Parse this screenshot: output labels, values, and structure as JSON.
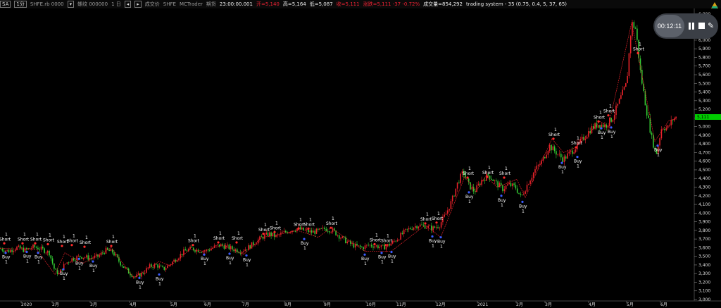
{
  "header": {
    "symbol_box": "SA",
    "interval_box": "1分",
    "symbol": "SHFE.rb 0000",
    "contract": "螺纹 000000",
    "period": "1 日",
    "price_type": "成交价",
    "exchange": "SHFE",
    "broker": "MCTrader",
    "account": "期货",
    "time": "23:00:00.001",
    "open": "开=5,140",
    "high": "高=5,164",
    "low": "低=5,087",
    "close": "收=5,111",
    "change": "涨跌=5,111 -37 -0.72%",
    "volume": "成交量=854,292",
    "strategy": "trading system - 35 (0.75, 0.4, 5, 37, 65)"
  },
  "recorder": {
    "time": "00:12:11",
    "pause_icon": "pause-icon",
    "stop_icon": "stop-icon",
    "edit_icon": "pencil-icon"
  },
  "colors": {
    "up": "#e8222a",
    "down": "#33cc33",
    "trade_line": "#e8222a",
    "last_price_bg": "#00cc00",
    "buy_marker": "#3a5bff",
    "short_marker": "#ff2a2a"
  },
  "chart_data": {
    "type": "candlestick",
    "title": "",
    "ylim": [
      3000,
      6350
    ],
    "y_ticks": [
      "6,300",
      "6,200",
      "6,100",
      "6,000",
      "5,900",
      "5,800",
      "5,700",
      "5,600",
      "5,500",
      "5,400",
      "5,300",
      "5,200",
      "5,100",
      "5,000",
      "4,900",
      "4,800",
      "4,700",
      "4,600",
      "4,500",
      "4,400",
      "4,300",
      "4,200",
      "4,100",
      "4,000",
      "3,900",
      "3,800",
      "3,700",
      "3,600",
      "3,500",
      "3,400",
      "3,300",
      "3,200",
      "3,100",
      "3,000"
    ],
    "x_ticks": [
      "2020",
      "2月",
      "3月",
      "4月",
      "5月",
      "6月",
      "7月",
      "8月",
      "9月",
      "10月",
      "11月",
      "12月",
      "2021",
      "2月",
      "3月",
      "4月",
      "5月",
      "6月"
    ],
    "last_price": "5,111",
    "price_path": [
      [
        0,
        3590
      ],
      [
        12,
        3560
      ],
      [
        24,
        3600
      ],
      [
        36,
        3570
      ],
      [
        48,
        3610
      ],
      [
        60,
        3580
      ],
      [
        70,
        3540
      ],
      [
        78,
        3330
      ],
      [
        84,
        3300
      ],
      [
        92,
        3410
      ],
      [
        102,
        3470
      ],
      [
        114,
        3500
      ],
      [
        128,
        3480
      ],
      [
        140,
        3500
      ],
      [
        150,
        3570
      ],
      [
        160,
        3550
      ],
      [
        170,
        3430
      ],
      [
        182,
        3320
      ],
      [
        192,
        3260
      ],
      [
        202,
        3300
      ],
      [
        212,
        3380
      ],
      [
        222,
        3400
      ],
      [
        232,
        3350
      ],
      [
        240,
        3400
      ],
      [
        250,
        3470
      ],
      [
        262,
        3560
      ],
      [
        272,
        3590
      ],
      [
        282,
        3570
      ],
      [
        292,
        3560
      ],
      [
        302,
        3600
      ],
      [
        312,
        3630
      ],
      [
        322,
        3610
      ],
      [
        332,
        3580
      ],
      [
        342,
        3560
      ],
      [
        352,
        3600
      ],
      [
        362,
        3660
      ],
      [
        372,
        3720
      ],
      [
        382,
        3760
      ],
      [
        392,
        3730
      ],
      [
        402,
        3770
      ],
      [
        412,
        3800
      ],
      [
        422,
        3820
      ],
      [
        432,
        3800
      ],
      [
        442,
        3780
      ],
      [
        452,
        3790
      ],
      [
        462,
        3820
      ],
      [
        472,
        3800
      ],
      [
        484,
        3720
      ],
      [
        494,
        3660
      ],
      [
        504,
        3620
      ],
      [
        514,
        3600
      ],
      [
        524,
        3630
      ],
      [
        534,
        3620
      ],
      [
        544,
        3600
      ],
      [
        554,
        3640
      ],
      [
        564,
        3700
      ],
      [
        574,
        3780
      ],
      [
        584,
        3830
      ],
      [
        594,
        3860
      ],
      [
        604,
        3850
      ],
      [
        614,
        3820
      ],
      [
        624,
        3860
      ],
      [
        634,
        4000
      ],
      [
        642,
        4150
      ],
      [
        650,
        4350
      ],
      [
        658,
        4480
      ],
      [
        666,
        4320
      ],
      [
        674,
        4250
      ],
      [
        684,
        4380
      ],
      [
        694,
        4440
      ],
      [
        704,
        4350
      ],
      [
        714,
        4280
      ],
      [
        722,
        4330
      ],
      [
        732,
        4300
      ],
      [
        740,
        4180
      ],
      [
        750,
        4350
      ],
      [
        760,
        4500
      ],
      [
        770,
        4600
      ],
      [
        780,
        4780
      ],
      [
        790,
        4700
      ],
      [
        800,
        4620
      ],
      [
        810,
        4700
      ],
      [
        820,
        4780
      ],
      [
        830,
        4880
      ],
      [
        840,
        4980
      ],
      [
        850,
        5030
      ],
      [
        860,
        5010
      ],
      [
        870,
        5100
      ],
      [
        880,
        5300
      ],
      [
        890,
        5500
      ],
      [
        897,
        6200
      ],
      [
        903,
        6130
      ],
      [
        910,
        5600
      ],
      [
        918,
        5200
      ],
      [
        926,
        4850
      ],
      [
        932,
        4680
      ],
      [
        940,
        5000
      ],
      [
        948,
        4980
      ],
      [
        956,
        5090
      ],
      [
        962,
        5111
      ]
    ],
    "trade_path": [
      [
        0,
        3590
      ],
      [
        52,
        3580
      ],
      [
        78,
        3290
      ],
      [
        92,
        3540
      ],
      [
        118,
        3420
      ],
      [
        158,
        3600
      ],
      [
        190,
        3250
      ],
      [
        226,
        3440
      ],
      [
        242,
        3390
      ],
      [
        270,
        3580
      ],
      [
        288,
        3560
      ],
      [
        318,
        3630
      ],
      [
        346,
        3520
      ],
      [
        372,
        3720
      ],
      [
        390,
        3740
      ],
      [
        422,
        3800
      ],
      [
        452,
        3720
      ],
      [
        470,
        3830
      ],
      [
        518,
        3560
      ],
      [
        556,
        3560
      ],
      [
        604,
        3860
      ],
      [
        626,
        3720
      ],
      [
        660,
        4420
      ],
      [
        676,
        4250
      ],
      [
        690,
        4430
      ],
      [
        706,
        4300
      ],
      [
        734,
        4390
      ],
      [
        746,
        4180
      ],
      [
        784,
        4860
      ],
      [
        800,
        4700
      ],
      [
        818,
        4760
      ],
      [
        852,
        5060
      ],
      [
        864,
        5000
      ],
      [
        897,
        6200
      ],
      [
        906,
        5840
      ],
      [
        930,
        4830
      ],
      [
        950,
        5070
      ],
      [
        960,
        5090
      ]
    ],
    "signals": [
      {
        "label": "Short",
        "qty": "1",
        "x": 6,
        "y": 3650,
        "type": "short"
      },
      {
        "label": "Short",
        "qty": "1",
        "x": 32,
        "y": 3650,
        "type": "short"
      },
      {
        "label": "Short",
        "qty": "1",
        "x": 50,
        "y": 3650,
        "type": "short"
      },
      {
        "label": "Short",
        "qty": "1",
        "x": 68,
        "y": 3640,
        "type": "short"
      },
      {
        "label": "Short",
        "qty": "1",
        "x": 88,
        "y": 3620,
        "type": "short"
      },
      {
        "label": "Short",
        "qty": "1",
        "x": 102,
        "y": 3630,
        "type": "short"
      },
      {
        "label": "Short",
        "qty": "1",
        "x": 120,
        "y": 3610,
        "type": "short"
      },
      {
        "label": "Short",
        "qty": "1",
        "x": 158,
        "y": 3620,
        "type": "short"
      },
      {
        "label": "Short",
        "qty": "1",
        "x": 274,
        "y": 3630,
        "type": "short"
      },
      {
        "label": "Short",
        "qty": "1",
        "x": 310,
        "y": 3660,
        "type": "short"
      },
      {
        "label": "Short",
        "qty": "1",
        "x": 336,
        "y": 3660,
        "type": "short"
      },
      {
        "label": "Short",
        "qty": "1",
        "x": 374,
        "y": 3760,
        "type": "short"
      },
      {
        "label": "Short",
        "qty": "1",
        "x": 390,
        "y": 3780,
        "type": "short"
      },
      {
        "label": "Short",
        "qty": "1",
        "x": 424,
        "y": 3820,
        "type": "short"
      },
      {
        "label": "Short",
        "qty": "1",
        "x": 438,
        "y": 3820,
        "type": "short"
      },
      {
        "label": "Short",
        "qty": "1",
        "x": 470,
        "y": 3830,
        "type": "short"
      },
      {
        "label": "Short",
        "qty": "1",
        "x": 532,
        "y": 3640,
        "type": "short"
      },
      {
        "label": "Short",
        "qty": "1",
        "x": 548,
        "y": 3630,
        "type": "short"
      },
      {
        "label": "Short",
        "qty": "1",
        "x": 604,
        "y": 3880,
        "type": "short"
      },
      {
        "label": "Short",
        "qty": "1",
        "x": 620,
        "y": 3890,
        "type": "short"
      },
      {
        "label": "Short",
        "qty": "1",
        "x": 664,
        "y": 4410,
        "type": "short"
      },
      {
        "label": "Short",
        "qty": "1",
        "x": 692,
        "y": 4420,
        "type": "short"
      },
      {
        "label": "Short",
        "qty": "1",
        "x": 716,
        "y": 4410,
        "type": "short"
      },
      {
        "label": "Short",
        "qty": "1",
        "x": 786,
        "y": 4860,
        "type": "short"
      },
      {
        "label": "Short",
        "qty": "1",
        "x": 818,
        "y": 4760,
        "type": "short"
      },
      {
        "label": "Short",
        "qty": "1",
        "x": 850,
        "y": 5060,
        "type": "short"
      },
      {
        "label": "Short",
        "qty": "1",
        "x": 864,
        "y": 5130,
        "type": "short"
      },
      {
        "label": "Short",
        "qty": "1",
        "x": 906,
        "y": 5850,
        "type": "short"
      },
      {
        "label": "Buy",
        "qty": "1",
        "x": 8,
        "y": 3540,
        "type": "buy"
      },
      {
        "label": "Buy",
        "qty": "1",
        "x": 38,
        "y": 3550,
        "type": "buy"
      },
      {
        "label": "Buy",
        "qty": "1",
        "x": 54,
        "y": 3540,
        "type": "buy"
      },
      {
        "label": "Buy",
        "qty": "1",
        "x": 90,
        "y": 3350,
        "type": "buy"
      },
      {
        "label": "Buy",
        "qty": "1",
        "x": 112,
        "y": 3470,
        "type": "buy"
      },
      {
        "label": "Buy",
        "qty": "1",
        "x": 132,
        "y": 3440,
        "type": "buy"
      },
      {
        "label": "Buy",
        "qty": "1",
        "x": 198,
        "y": 3250,
        "type": "buy"
      },
      {
        "label": "Buy",
        "qty": "1",
        "x": 226,
        "y": 3290,
        "type": "buy"
      },
      {
        "label": "Buy",
        "qty": "1",
        "x": 290,
        "y": 3520,
        "type": "buy"
      },
      {
        "label": "Buy",
        "qty": "1",
        "x": 326,
        "y": 3530,
        "type": "buy"
      },
      {
        "label": "Buy",
        "qty": "1",
        "x": 350,
        "y": 3510,
        "type": "buy"
      },
      {
        "label": "Buy",
        "qty": "1",
        "x": 432,
        "y": 3700,
        "type": "buy"
      },
      {
        "label": "Buy",
        "qty": "1",
        "x": 518,
        "y": 3520,
        "type": "buy"
      },
      {
        "label": "Buy",
        "qty": "1",
        "x": 542,
        "y": 3540,
        "type": "buy"
      },
      {
        "label": "Buy",
        "qty": "1",
        "x": 556,
        "y": 3550,
        "type": "buy"
      },
      {
        "label": "Buy",
        "qty": "1",
        "x": 614,
        "y": 3730,
        "type": "buy"
      },
      {
        "label": "Buy",
        "qty": "1",
        "x": 626,
        "y": 3720,
        "type": "buy"
      },
      {
        "label": "Buy",
        "qty": "1",
        "x": 666,
        "y": 4240,
        "type": "buy"
      },
      {
        "label": "Buy",
        "qty": "1",
        "x": 712,
        "y": 4200,
        "type": "buy"
      },
      {
        "label": "Buy",
        "qty": "1",
        "x": 742,
        "y": 4130,
        "type": "buy"
      },
      {
        "label": "Buy",
        "qty": "1",
        "x": 798,
        "y": 4580,
        "type": "buy"
      },
      {
        "label": "Buy",
        "qty": "1",
        "x": 820,
        "y": 4650,
        "type": "buy"
      },
      {
        "label": "Buy",
        "qty": "1",
        "x": 854,
        "y": 4980,
        "type": "buy"
      },
      {
        "label": "Buy",
        "qty": "1",
        "x": 868,
        "y": 4990,
        "type": "buy"
      },
      {
        "label": "Buy",
        "qty": "1",
        "x": 934,
        "y": 4780,
        "type": "buy"
      }
    ]
  }
}
